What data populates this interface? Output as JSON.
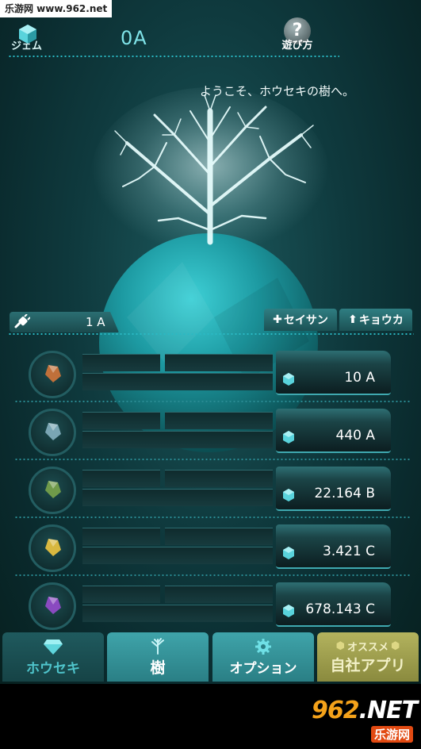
{
  "watermark_top": "乐游网 www.962.net",
  "watermark_logo": {
    "big": "962",
    "dot": ".NET",
    "small": "乐游网"
  },
  "header": {
    "gem_label": "ジェム",
    "currency": "0A",
    "help_symbol": "?",
    "help_label": "遊び方"
  },
  "welcome": "ようこそ、ホウセキの樹へ。",
  "stats": {
    "power_value": "1 A",
    "produce_label": "セイサン",
    "produce_icon": "plus-icon",
    "strengthen_label": "キョウカ",
    "strengthen_icon": "up-arrow-icon"
  },
  "items": [
    {
      "price": "10 A",
      "gem_color": "#c0703a"
    },
    {
      "price": "440 A",
      "gem_color": "#7aa6b4"
    },
    {
      "price": "22.164 B",
      "gem_color": "#6f9a4a"
    },
    {
      "price": "3.421 C",
      "gem_color": "#d8b840"
    },
    {
      "price": "678.143 C",
      "gem_color": "#8a4ac0"
    }
  ],
  "nav": [
    {
      "label": "ホウセキ",
      "icon": "diamond-icon"
    },
    {
      "label": "樹",
      "icon": "tree-icon"
    },
    {
      "label": "オプション",
      "icon": "gear-icon"
    },
    {
      "label": "自社アプリ",
      "sub": "オススメ",
      "icon": "hexagon-icon"
    }
  ],
  "colors": {
    "accent": "#2ab9c4",
    "currency": "#7fe3e8",
    "ad_tab": "#9a9a4a"
  }
}
